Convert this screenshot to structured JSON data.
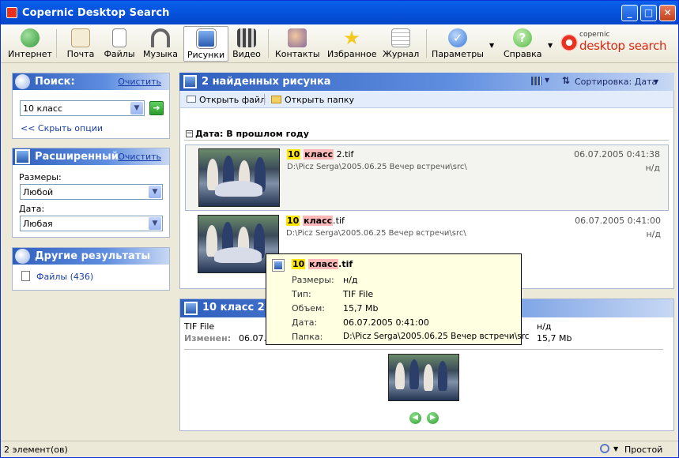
{
  "window": {
    "title": "Copernic Desktop Search"
  },
  "toolbar": {
    "items": [
      {
        "label": "Интернет",
        "icon": "globe-icon",
        "color": "#3a9a3a"
      },
      {
        "label": "Почта",
        "icon": "envelope-icon",
        "color": "#d8c49a"
      },
      {
        "label": "Файлы",
        "icon": "document-icon",
        "color": "#c8c8c8"
      },
      {
        "label": "Музыка",
        "icon": "headphones-icon",
        "color": "#777777"
      },
      {
        "label": "Рисунки",
        "icon": "picture-icon",
        "color": "#4a7ac8"
      },
      {
        "label": "Видео",
        "icon": "film-clapper-icon",
        "color": "#555555"
      },
      {
        "label": "Контакты",
        "icon": "contacts-icon",
        "color": "#8a6a9a"
      },
      {
        "label": "Избранное",
        "icon": "star-icon",
        "color": "#f4c81e"
      },
      {
        "label": "Журнал",
        "icon": "journal-icon",
        "color": "#b0b0b0"
      },
      {
        "label": "Параметры",
        "icon": "checkmark-icon",
        "color": "#3a7ad8"
      },
      {
        "label": "Справка",
        "icon": "help-icon",
        "color": "#58b848"
      }
    ],
    "selected": "Рисунки",
    "logo_top": "copernic",
    "logo_main": "desktop search"
  },
  "search": {
    "title": "Поиск:",
    "clear": "Очистить",
    "value": "10 класс",
    "hide_options": "<< Скрыть опции"
  },
  "advanced": {
    "title": "Расширенный",
    "clear": "Очистить",
    "size_label": "Размеры:",
    "size_value": "Любой",
    "date_label": "Дата:",
    "date_value": "Любая"
  },
  "other": {
    "title": "Другие результаты",
    "files": "Файлы (436)"
  },
  "results": {
    "title": "2 найденных рисунка",
    "sort": "Сортировка: Дата",
    "open_file": "Открыть файл",
    "open_folder": "Открыть папку",
    "group": "Дата: В прошлом году",
    "items": [
      {
        "hl1": "10",
        "hl2": "класс",
        "rest": " 2.tif",
        "path": "D:\\Picz Serga\\2005.06.25 Вечер встречи\\src\\",
        "date": "06.07.2005 0:41:38",
        "size": "н/д"
      },
      {
        "hl1": "10",
        "hl2": "класс",
        "rest": ".tif",
        "path": "D:\\Picz Serga\\2005.06.25 Вечер встречи\\src\\",
        "date": "06.07.2005 0:41:00",
        "size": "н/д"
      }
    ]
  },
  "tooltip": {
    "hl1": "10",
    "hl2": "класс",
    "rest": ".tif",
    "rows": [
      {
        "k": "Размеры:",
        "v": "н/д"
      },
      {
        "k": "Тип:",
        "v": "TIF File"
      },
      {
        "k": "Объем:",
        "v": "15,7 Mb"
      },
      {
        "k": "Дата:",
        "v": "06.07.2005 0:41:00"
      },
      {
        "k": "Папка:",
        "v": "D:\\Picz Serga\\2005.06.25 Вечер встречи\\src"
      }
    ]
  },
  "preview": {
    "title": "10 класс 2.t",
    "type": "TIF File",
    "modified_label": "Изменен:",
    "modified_value": "06.07.2",
    "size_na": "н/д",
    "size": "15,7 Mb"
  },
  "status": {
    "count": "2 элемент(ов)",
    "mode": "Простой"
  }
}
